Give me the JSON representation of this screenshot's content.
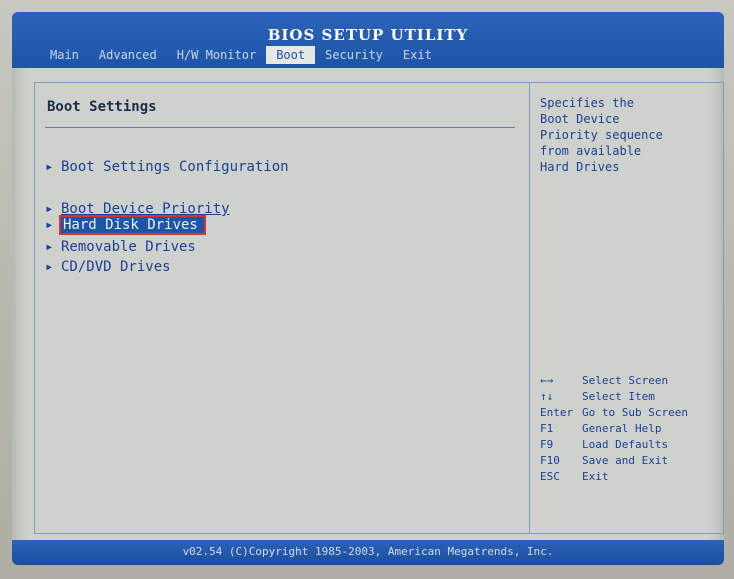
{
  "header": {
    "title": "BIOS SETUP UTILITY",
    "tabs": [
      {
        "label": "Main"
      },
      {
        "label": "Advanced"
      },
      {
        "label": "H/W Monitor"
      },
      {
        "label": "Boot",
        "active": true
      },
      {
        "label": "Security"
      },
      {
        "label": "Exit"
      }
    ]
  },
  "main": {
    "section_title": "Boot Settings",
    "items": [
      {
        "label": "Boot Settings Configuration"
      },
      {
        "label": "Boot Device Priority"
      },
      {
        "label": "Hard Disk Drives",
        "selected": true
      },
      {
        "label": "Removable Drives"
      },
      {
        "label": "CD/DVD Drives"
      }
    ]
  },
  "help": {
    "text": "Specifies the\nBoot Device\nPriority sequence\nfrom available\nHard Drives"
  },
  "keys": [
    {
      "key": "←→",
      "action": "Select Screen"
    },
    {
      "key": "↑↓",
      "action": "Select Item"
    },
    {
      "key": "Enter",
      "action": "Go to Sub Screen"
    },
    {
      "key": "F1",
      "action": "General Help"
    },
    {
      "key": "F9",
      "action": "Load Defaults"
    },
    {
      "key": "F10",
      "action": "Save and Exit"
    },
    {
      "key": "ESC",
      "action": "Exit"
    }
  ],
  "footer": {
    "copyright": "v02.54 (C)Copyright 1985-2003, American Megatrends, Inc."
  },
  "colors": {
    "bar_blue": "#1f55a8",
    "screen_bg": "#cfd2cc",
    "text_blue": "#1b3f96",
    "highlight_border": "#e0302a"
  }
}
